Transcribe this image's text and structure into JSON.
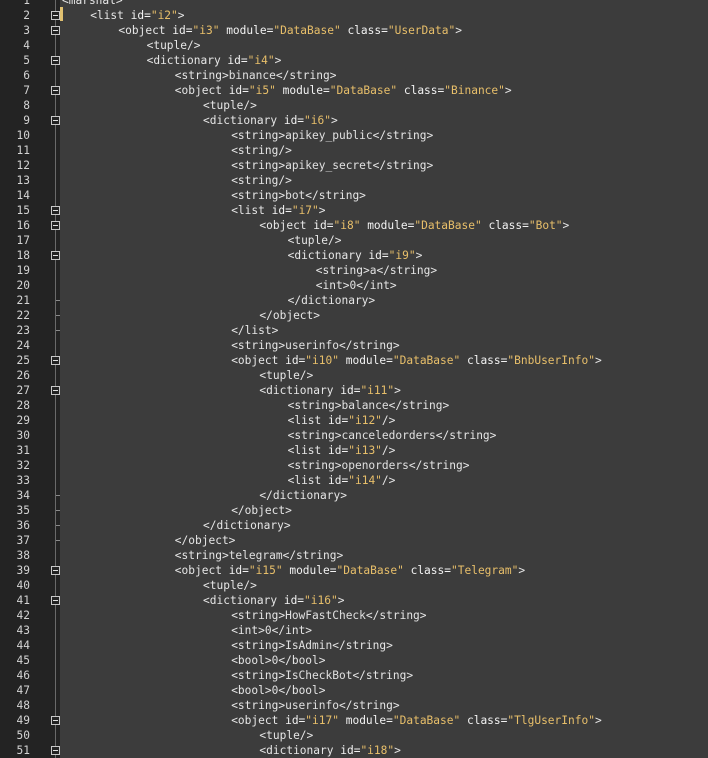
{
  "lines": [
    {
      "n": "1",
      "indent": 0,
      "fold": "",
      "tokens": [
        [
          "tag",
          "<marshal>"
        ]
      ]
    },
    {
      "n": "2",
      "indent": 1,
      "fold": "box",
      "tokens": [
        [
          "tag",
          "<list "
        ],
        [
          "attr",
          "id="
        ],
        [
          "val",
          "\"i2\""
        ],
        [
          "tag",
          ">"
        ]
      ]
    },
    {
      "n": "3",
      "indent": 2,
      "fold": "box",
      "tokens": [
        [
          "tag",
          "<object "
        ],
        [
          "attr",
          "id="
        ],
        [
          "val",
          "\"i3\""
        ],
        [
          "attr",
          " module="
        ],
        [
          "val",
          "\"DataBase\""
        ],
        [
          "attr",
          " class="
        ],
        [
          "val",
          "\"UserData\""
        ],
        [
          "tag",
          ">"
        ]
      ]
    },
    {
      "n": "4",
      "indent": 3,
      "fold": "",
      "tokens": [
        [
          "tag",
          "<tuple/>"
        ]
      ]
    },
    {
      "n": "5",
      "indent": 3,
      "fold": "box",
      "tokens": [
        [
          "tag",
          "<dictionary "
        ],
        [
          "attr",
          "id="
        ],
        [
          "val",
          "\"i4\""
        ],
        [
          "tag",
          ">"
        ]
      ]
    },
    {
      "n": "6",
      "indent": 4,
      "fold": "",
      "tokens": [
        [
          "tag",
          "<string>"
        ],
        [
          "txt",
          "binance"
        ],
        [
          "tag",
          "</string>"
        ]
      ]
    },
    {
      "n": "7",
      "indent": 4,
      "fold": "box",
      "tokens": [
        [
          "tag",
          "<object "
        ],
        [
          "attr",
          "id="
        ],
        [
          "val",
          "\"i5\""
        ],
        [
          "attr",
          " module="
        ],
        [
          "val",
          "\"DataBase\""
        ],
        [
          "attr",
          " class="
        ],
        [
          "val",
          "\"Binance\""
        ],
        [
          "tag",
          ">"
        ]
      ]
    },
    {
      "n": "8",
      "indent": 5,
      "fold": "",
      "tokens": [
        [
          "tag",
          "<tuple/>"
        ]
      ]
    },
    {
      "n": "9",
      "indent": 5,
      "fold": "box",
      "tokens": [
        [
          "tag",
          "<dictionary "
        ],
        [
          "attr",
          "id="
        ],
        [
          "val",
          "\"i6\""
        ],
        [
          "tag",
          ">"
        ]
      ]
    },
    {
      "n": "10",
      "indent": 6,
      "fold": "",
      "tokens": [
        [
          "tag",
          "<string>"
        ],
        [
          "txt",
          "apikey_public"
        ],
        [
          "tag",
          "</string>"
        ]
      ]
    },
    {
      "n": "11",
      "indent": 6,
      "fold": "",
      "tokens": [
        [
          "tag",
          "<string/>"
        ]
      ]
    },
    {
      "n": "12",
      "indent": 6,
      "fold": "",
      "tokens": [
        [
          "tag",
          "<string>"
        ],
        [
          "txt",
          "apikey_secret"
        ],
        [
          "tag",
          "</string>"
        ]
      ]
    },
    {
      "n": "13",
      "indent": 6,
      "fold": "",
      "tokens": [
        [
          "tag",
          "<string/>"
        ]
      ]
    },
    {
      "n": "14",
      "indent": 6,
      "fold": "",
      "tokens": [
        [
          "tag",
          "<string>"
        ],
        [
          "txt",
          "bot"
        ],
        [
          "tag",
          "</string>"
        ]
      ]
    },
    {
      "n": "15",
      "indent": 6,
      "fold": "box",
      "tokens": [
        [
          "tag",
          "<list "
        ],
        [
          "attr",
          "id="
        ],
        [
          "val",
          "\"i7\""
        ],
        [
          "tag",
          ">"
        ]
      ]
    },
    {
      "n": "16",
      "indent": 7,
      "fold": "box",
      "tokens": [
        [
          "tag",
          "<object "
        ],
        [
          "attr",
          "id="
        ],
        [
          "val",
          "\"i8\""
        ],
        [
          "attr",
          " module="
        ],
        [
          "val",
          "\"DataBase\""
        ],
        [
          "attr",
          " class="
        ],
        [
          "val",
          "\"Bot\""
        ],
        [
          "tag",
          ">"
        ]
      ]
    },
    {
      "n": "17",
      "indent": 8,
      "fold": "",
      "tokens": [
        [
          "tag",
          "<tuple/>"
        ]
      ]
    },
    {
      "n": "18",
      "indent": 8,
      "fold": "box",
      "tokens": [
        [
          "tag",
          "<dictionary "
        ],
        [
          "attr",
          "id="
        ],
        [
          "val",
          "\"i9\""
        ],
        [
          "tag",
          ">"
        ]
      ]
    },
    {
      "n": "19",
      "indent": 9,
      "fold": "",
      "tokens": [
        [
          "tag",
          "<string>"
        ],
        [
          "txt",
          "a"
        ],
        [
          "tag",
          "</string>"
        ]
      ]
    },
    {
      "n": "20",
      "indent": 9,
      "fold": "",
      "tokens": [
        [
          "tag",
          "<int>"
        ],
        [
          "txt",
          "0"
        ],
        [
          "tag",
          "</int>"
        ]
      ]
    },
    {
      "n": "21",
      "indent": 8,
      "fold": "end",
      "tokens": [
        [
          "tag",
          "</dictionary>"
        ]
      ]
    },
    {
      "n": "22",
      "indent": 7,
      "fold": "end",
      "tokens": [
        [
          "tag",
          "</object>"
        ]
      ]
    },
    {
      "n": "23",
      "indent": 6,
      "fold": "end",
      "tokens": [
        [
          "tag",
          "</list>"
        ]
      ]
    },
    {
      "n": "24",
      "indent": 6,
      "fold": "",
      "tokens": [
        [
          "tag",
          "<string>"
        ],
        [
          "txt",
          "userinfo"
        ],
        [
          "tag",
          "</string>"
        ]
      ]
    },
    {
      "n": "25",
      "indent": 6,
      "fold": "box",
      "tokens": [
        [
          "tag",
          "<object "
        ],
        [
          "attr",
          "id="
        ],
        [
          "val",
          "\"i10\""
        ],
        [
          "attr",
          " module="
        ],
        [
          "val",
          "\"DataBase\""
        ],
        [
          "attr",
          " class="
        ],
        [
          "val",
          "\"BnbUserInfo\""
        ],
        [
          "tag",
          ">"
        ]
      ]
    },
    {
      "n": "26",
      "indent": 7,
      "fold": "",
      "tokens": [
        [
          "tag",
          "<tuple/>"
        ]
      ]
    },
    {
      "n": "27",
      "indent": 7,
      "fold": "box",
      "tokens": [
        [
          "tag",
          "<dictionary "
        ],
        [
          "attr",
          "id="
        ],
        [
          "val",
          "\"i11\""
        ],
        [
          "tag",
          ">"
        ]
      ]
    },
    {
      "n": "28",
      "indent": 8,
      "fold": "",
      "tokens": [
        [
          "tag",
          "<string>"
        ],
        [
          "txt",
          "balance"
        ],
        [
          "tag",
          "</string>"
        ]
      ]
    },
    {
      "n": "29",
      "indent": 8,
      "fold": "",
      "tokens": [
        [
          "tag",
          "<list "
        ],
        [
          "attr",
          "id="
        ],
        [
          "val",
          "\"i12\""
        ],
        [
          "tag",
          "/>"
        ]
      ]
    },
    {
      "n": "30",
      "indent": 8,
      "fold": "",
      "tokens": [
        [
          "tag",
          "<string>"
        ],
        [
          "txt",
          "canceledorders"
        ],
        [
          "tag",
          "</string>"
        ]
      ]
    },
    {
      "n": "31",
      "indent": 8,
      "fold": "",
      "tokens": [
        [
          "tag",
          "<list "
        ],
        [
          "attr",
          "id="
        ],
        [
          "val",
          "\"i13\""
        ],
        [
          "tag",
          "/>"
        ]
      ]
    },
    {
      "n": "32",
      "indent": 8,
      "fold": "",
      "tokens": [
        [
          "tag",
          "<string>"
        ],
        [
          "txt",
          "openorders"
        ],
        [
          "tag",
          "</string>"
        ]
      ]
    },
    {
      "n": "33",
      "indent": 8,
      "fold": "",
      "tokens": [
        [
          "tag",
          "<list "
        ],
        [
          "attr",
          "id="
        ],
        [
          "val",
          "\"i14\""
        ],
        [
          "tag",
          "/>"
        ]
      ]
    },
    {
      "n": "34",
      "indent": 7,
      "fold": "end",
      "tokens": [
        [
          "tag",
          "</dictionary>"
        ]
      ]
    },
    {
      "n": "35",
      "indent": 6,
      "fold": "end",
      "tokens": [
        [
          "tag",
          "</object>"
        ]
      ]
    },
    {
      "n": "36",
      "indent": 5,
      "fold": "end",
      "tokens": [
        [
          "tag",
          "</dictionary>"
        ]
      ]
    },
    {
      "n": "37",
      "indent": 4,
      "fold": "end",
      "tokens": [
        [
          "tag",
          "</object>"
        ]
      ]
    },
    {
      "n": "38",
      "indent": 4,
      "fold": "",
      "tokens": [
        [
          "tag",
          "<string>"
        ],
        [
          "txt",
          "telegram"
        ],
        [
          "tag",
          "</string>"
        ]
      ]
    },
    {
      "n": "39",
      "indent": 4,
      "fold": "box",
      "tokens": [
        [
          "tag",
          "<object "
        ],
        [
          "attr",
          "id="
        ],
        [
          "val",
          "\"i15\""
        ],
        [
          "attr",
          " module="
        ],
        [
          "val",
          "\"DataBase\""
        ],
        [
          "attr",
          " class="
        ],
        [
          "val",
          "\"Telegram\""
        ],
        [
          "tag",
          ">"
        ]
      ]
    },
    {
      "n": "40",
      "indent": 5,
      "fold": "",
      "tokens": [
        [
          "tag",
          "<tuple/>"
        ]
      ]
    },
    {
      "n": "41",
      "indent": 5,
      "fold": "box",
      "tokens": [
        [
          "tag",
          "<dictionary "
        ],
        [
          "attr",
          "id="
        ],
        [
          "val",
          "\"i16\""
        ],
        [
          "tag",
          ">"
        ]
      ]
    },
    {
      "n": "42",
      "indent": 6,
      "fold": "",
      "tokens": [
        [
          "tag",
          "<string>"
        ],
        [
          "txt",
          "HowFastCheck"
        ],
        [
          "tag",
          "</string>"
        ]
      ]
    },
    {
      "n": "43",
      "indent": 6,
      "fold": "",
      "tokens": [
        [
          "tag",
          "<int>"
        ],
        [
          "txt",
          "0"
        ],
        [
          "tag",
          "</int>"
        ]
      ]
    },
    {
      "n": "44",
      "indent": 6,
      "fold": "",
      "tokens": [
        [
          "tag",
          "<string>"
        ],
        [
          "txt",
          "IsAdmin"
        ],
        [
          "tag",
          "</string>"
        ]
      ]
    },
    {
      "n": "45",
      "indent": 6,
      "fold": "",
      "tokens": [
        [
          "tag",
          "<bool>"
        ],
        [
          "txt",
          "0"
        ],
        [
          "tag",
          "</bool>"
        ]
      ]
    },
    {
      "n": "46",
      "indent": 6,
      "fold": "",
      "tokens": [
        [
          "tag",
          "<string>"
        ],
        [
          "txt",
          "IsCheckBot"
        ],
        [
          "tag",
          "</string>"
        ]
      ]
    },
    {
      "n": "47",
      "indent": 6,
      "fold": "",
      "tokens": [
        [
          "tag",
          "<bool>"
        ],
        [
          "txt",
          "0"
        ],
        [
          "tag",
          "</bool>"
        ]
      ]
    },
    {
      "n": "48",
      "indent": 6,
      "fold": "",
      "tokens": [
        [
          "tag",
          "<string>"
        ],
        [
          "txt",
          "userinfo"
        ],
        [
          "tag",
          "</string>"
        ]
      ]
    },
    {
      "n": "49",
      "indent": 6,
      "fold": "box",
      "tokens": [
        [
          "tag",
          "<object "
        ],
        [
          "attr",
          "id="
        ],
        [
          "val",
          "\"i17\""
        ],
        [
          "attr",
          " module="
        ],
        [
          "val",
          "\"DataBase\""
        ],
        [
          "attr",
          " class="
        ],
        [
          "val",
          "\"TlgUserInfo\""
        ],
        [
          "tag",
          ">"
        ]
      ]
    },
    {
      "n": "50",
      "indent": 7,
      "fold": "",
      "tokens": [
        [
          "tag",
          "<tuple/>"
        ]
      ]
    },
    {
      "n": "51",
      "indent": 7,
      "fold": "box",
      "tokens": [
        [
          "tag",
          "<dictionary "
        ],
        [
          "attr",
          "id="
        ],
        [
          "val",
          "\"i18\""
        ],
        [
          "tag",
          ">"
        ]
      ]
    }
  ]
}
